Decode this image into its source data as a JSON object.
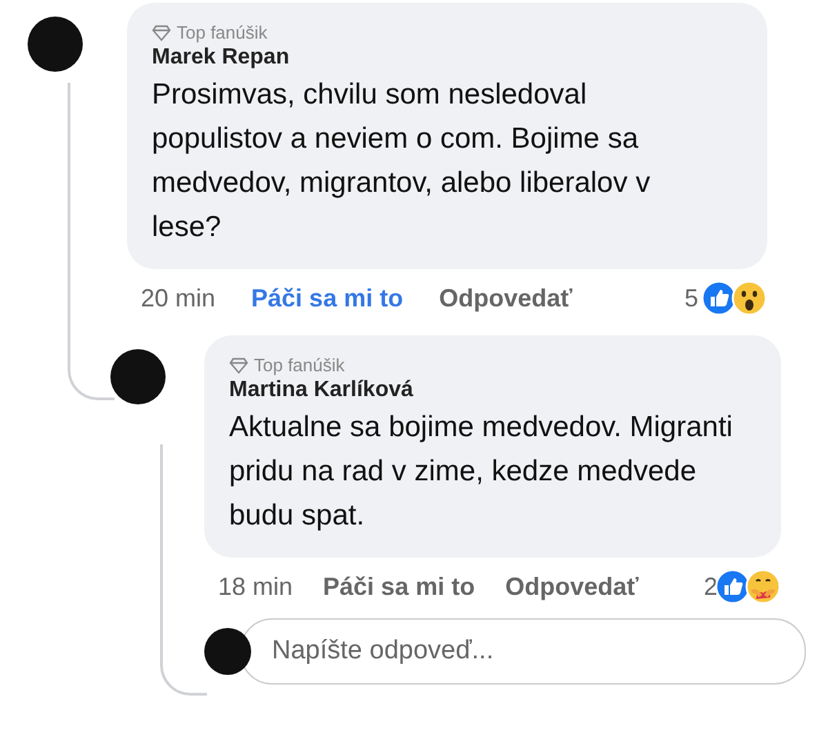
{
  "comments": [
    {
      "badge": "Top fanúšik",
      "author": "Marek Repan",
      "text": "Prosimvas, chvilu som nesledoval populistov a neviem o com. Bojime sa medvedov, migrantov, alebo liberalov v lese?",
      "time": "20 min",
      "like": {
        "label": "Páči sa mi to",
        "selected": true
      },
      "reply": "Odpovedať",
      "reaction_count": "5",
      "reactions": [
        {
          "kind": "like"
        },
        {
          "kind": "wow"
        }
      ]
    },
    {
      "badge": "Top fanúšik",
      "author": "Martina Karlíková",
      "text": "Aktualne sa bojime medvedov. Migranti pridu na rad v zime, kedze medvede budu spat.",
      "time": "18 min",
      "like": {
        "label": "Páči sa mi to",
        "selected": false
      },
      "reply": "Odpovedať",
      "reaction_count": "2",
      "reactions": [
        {
          "kind": "like"
        },
        {
          "kind": "care"
        }
      ]
    }
  ],
  "reply_field": {
    "placeholder": "Napíšte odpoveď..."
  }
}
